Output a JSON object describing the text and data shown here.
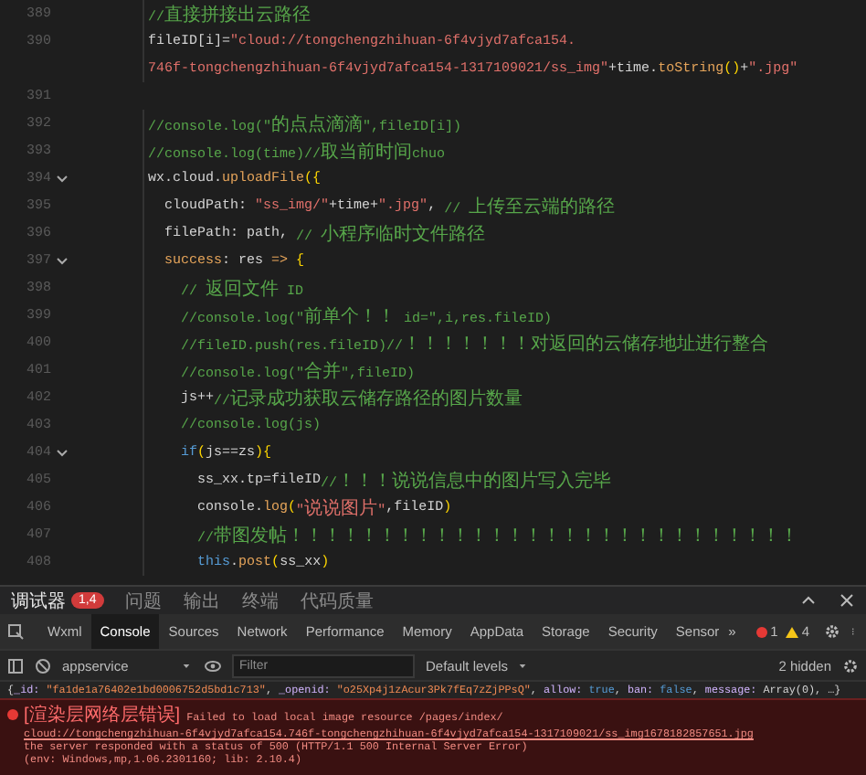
{
  "editor": {
    "lines": [
      {
        "number": "389",
        "fold": false,
        "tokens": [
          {
            "kind": "comment",
            "text": "//直接拼接出云路径"
          }
        ]
      },
      {
        "number": "390",
        "fold": false,
        "tokens": [
          {
            "kind": "plain",
            "text": "fileID[i]="
          },
          {
            "kind": "string",
            "text": "\"cloud://tongchengzhihuan-6f4vjyd7afca154."
          }
        ]
      },
      {
        "fold": false,
        "tokens": [
          {
            "kind": "string",
            "text": "746f-tongchengzhihuan-6f4vjyd7afca154-1317109021/ss_img\""
          },
          {
            "kind": "plain",
            "text": "+time."
          },
          {
            "kind": "fn",
            "text": "toString"
          },
          {
            "kind": "bracket",
            "text": "()"
          },
          {
            "kind": "plain",
            "text": "+"
          },
          {
            "kind": "string",
            "text": "\".jpg\""
          }
        ]
      },
      {
        "number": "391",
        "fold": false
      },
      {
        "number": "392",
        "fold": false,
        "tokens": [
          {
            "kind": "comment",
            "text": "//console.log(\"的点点滴滴\",fileID[i])"
          }
        ]
      },
      {
        "number": "393",
        "fold": false,
        "tokens": [
          {
            "kind": "comment",
            "text": "//console.log(time)//取当前时间chuo"
          }
        ]
      },
      {
        "number": "394",
        "fold": true,
        "tokens": [
          {
            "kind": "plain",
            "text": "wx.cloud."
          },
          {
            "kind": "fn",
            "text": "uploadFile"
          },
          {
            "kind": "bracket",
            "text": "({"
          }
        ]
      },
      {
        "number": "395",
        "fold": false,
        "tokens": [
          {
            "kind": "plain",
            "text": "  cloudPath: "
          },
          {
            "kind": "string",
            "text": "\"ss_img/\""
          },
          {
            "kind": "plain",
            "text": "+time+"
          },
          {
            "kind": "string",
            "text": "\".jpg\""
          },
          {
            "kind": "plain",
            "text": ", "
          },
          {
            "kind": "comment",
            "text": "// 上传至云端的路径"
          }
        ]
      },
      {
        "number": "396",
        "fold": false,
        "tokens": [
          {
            "kind": "plain",
            "text": "  filePath: path, "
          },
          {
            "kind": "comment",
            "text": "// 小程序临时文件路径"
          }
        ]
      },
      {
        "number": "397",
        "fold": true,
        "tokens": [
          {
            "kind": "fn",
            "text": "  success"
          },
          {
            "kind": "plain",
            "text": ": res "
          },
          {
            "kind": "fn",
            "text": "=>"
          },
          {
            "kind": "bracket",
            "text": " {"
          }
        ]
      },
      {
        "number": "398",
        "fold": false,
        "tokens": [
          {
            "kind": "comment",
            "text": "    // 返回文件 ID"
          }
        ]
      },
      {
        "number": "399",
        "fold": false,
        "tokens": [
          {
            "kind": "comment",
            "text": "    //console.log(\"前单个！！ id=\",i,res.fileID)"
          }
        ]
      },
      {
        "number": "400",
        "fold": false,
        "tokens": [
          {
            "kind": "comment",
            "text": "    //fileID.push(res.fileID)//！！！！！！！对返回的云储存地址进行整合"
          }
        ]
      },
      {
        "number": "401",
        "fold": false,
        "tokens": [
          {
            "kind": "comment",
            "text": "    //console.log(\"合并\",fileID)"
          }
        ]
      },
      {
        "number": "402",
        "fold": false,
        "tokens": [
          {
            "kind": "plain",
            "text": "    js++"
          },
          {
            "kind": "comment",
            "text": "//记录成功获取云储存路径的图片数量"
          }
        ]
      },
      {
        "number": "403",
        "fold": false,
        "tokens": [
          {
            "kind": "comment",
            "text": "    //console.log(js)"
          }
        ]
      },
      {
        "number": "404",
        "fold": true,
        "tokens": [
          {
            "kind": "keyword",
            "text": "    if"
          },
          {
            "kind": "bracket",
            "text": "("
          },
          {
            "kind": "plain",
            "text": "js==zs"
          },
          {
            "kind": "bracket",
            "text": "){"
          }
        ]
      },
      {
        "number": "405",
        "fold": false,
        "tokens": [
          {
            "kind": "plain",
            "text": "      ss_xx.tp=fileID"
          },
          {
            "kind": "comment",
            "text": "//！！！说说信息中的图片写入完毕"
          }
        ]
      },
      {
        "number": "406",
        "fold": false,
        "tokens": [
          {
            "kind": "plain",
            "text": "      console."
          },
          {
            "kind": "fn",
            "text": "log"
          },
          {
            "kind": "bracket",
            "text": "("
          },
          {
            "kind": "string",
            "text": "\"说说图片\""
          },
          {
            "kind": "plain",
            "text": ",fileID"
          },
          {
            "kind": "bracket",
            "text": ")"
          }
        ]
      },
      {
        "number": "407",
        "fold": false,
        "tokens": [
          {
            "kind": "comment",
            "text": "      //带图发帖！！！！！！！！！！！！！！！！！！！！！！！！！！！！"
          }
        ]
      },
      {
        "number": "408",
        "fold": false,
        "tokens": [
          {
            "kind": "keyword",
            "text": "      this"
          },
          {
            "kind": "plain",
            "text": "."
          },
          {
            "kind": "fn",
            "text": "post"
          },
          {
            "kind": "bracket",
            "text": "("
          },
          {
            "kind": "plain",
            "text": "ss_xx"
          },
          {
            "kind": "bracket",
            "text": ")"
          }
        ]
      }
    ]
  },
  "bottom_panel": {
    "tabs": [
      {
        "label": "调试器",
        "badge": "1,4",
        "selected": true
      },
      {
        "label": "问题",
        "selected": false
      },
      {
        "label": "输出",
        "selected": false
      },
      {
        "label": "终端",
        "selected": false
      },
      {
        "label": "代码质量",
        "selected": false
      }
    ],
    "devtools": {
      "tabs": [
        {
          "label": "Wxml",
          "selected": false
        },
        {
          "label": "Console",
          "selected": true
        },
        {
          "label": "Sources",
          "selected": false
        },
        {
          "label": "Network",
          "selected": false
        },
        {
          "label": "Performance",
          "selected": false
        },
        {
          "label": "Memory",
          "selected": false
        },
        {
          "label": "AppData",
          "selected": false
        },
        {
          "label": "Storage",
          "selected": false
        },
        {
          "label": "Security",
          "selected": false
        },
        {
          "label": "Sensor",
          "selected": false
        }
      ],
      "overflow": "»",
      "errors": "1",
      "warnings": "4"
    },
    "console": {
      "context": "appservice",
      "filter": {
        "placeholder": "Filter"
      },
      "levels": "Default levels",
      "hidden": "2 hidden",
      "object_entry": [
        {
          "kind": "plain",
          "text": "{"
        },
        {
          "kind": "key",
          "text": "_id: "
        },
        {
          "kind": "string",
          "text": "\"fa1de1a76402e1bd0006752d5bd1c713\""
        },
        {
          "kind": "plain",
          "text": ", "
        },
        {
          "kind": "key",
          "text": "_openid: "
        },
        {
          "kind": "string",
          "text": "\"o25Xp4j1zAcur3Pk7fEq7zZjPPsQ\""
        },
        {
          "kind": "plain",
          "text": ", "
        },
        {
          "kind": "key",
          "text": "allow: "
        },
        {
          "kind": "keyword",
          "text": "true"
        },
        {
          "kind": "plain",
          "text": ", "
        },
        {
          "kind": "key",
          "text": "ban: "
        },
        {
          "kind": "keyword",
          "text": "false"
        },
        {
          "kind": "plain",
          "text": ", "
        },
        {
          "kind": "key",
          "text": "message: "
        },
        {
          "kind": "plain",
          "text": "Array(0), …}"
        }
      ],
      "error": {
        "prefix": "[渲染层网络层错误]",
        "message": "Failed to load local image resource /pages/index/",
        "link": "cloud://tongchengzhihuan-6f4vjyd7afca154.746f-tongchengzhihuan-6f4vjyd7afca154-1317109021/ss_img1678182857651.jpg",
        "details": [
          "the server responded with a status of 500 (HTTP/1.1 500 Internal Server Error)",
          "(env: Windows,mp,1.06.2301160; lib: 2.10.4)"
        ]
      }
    }
  }
}
